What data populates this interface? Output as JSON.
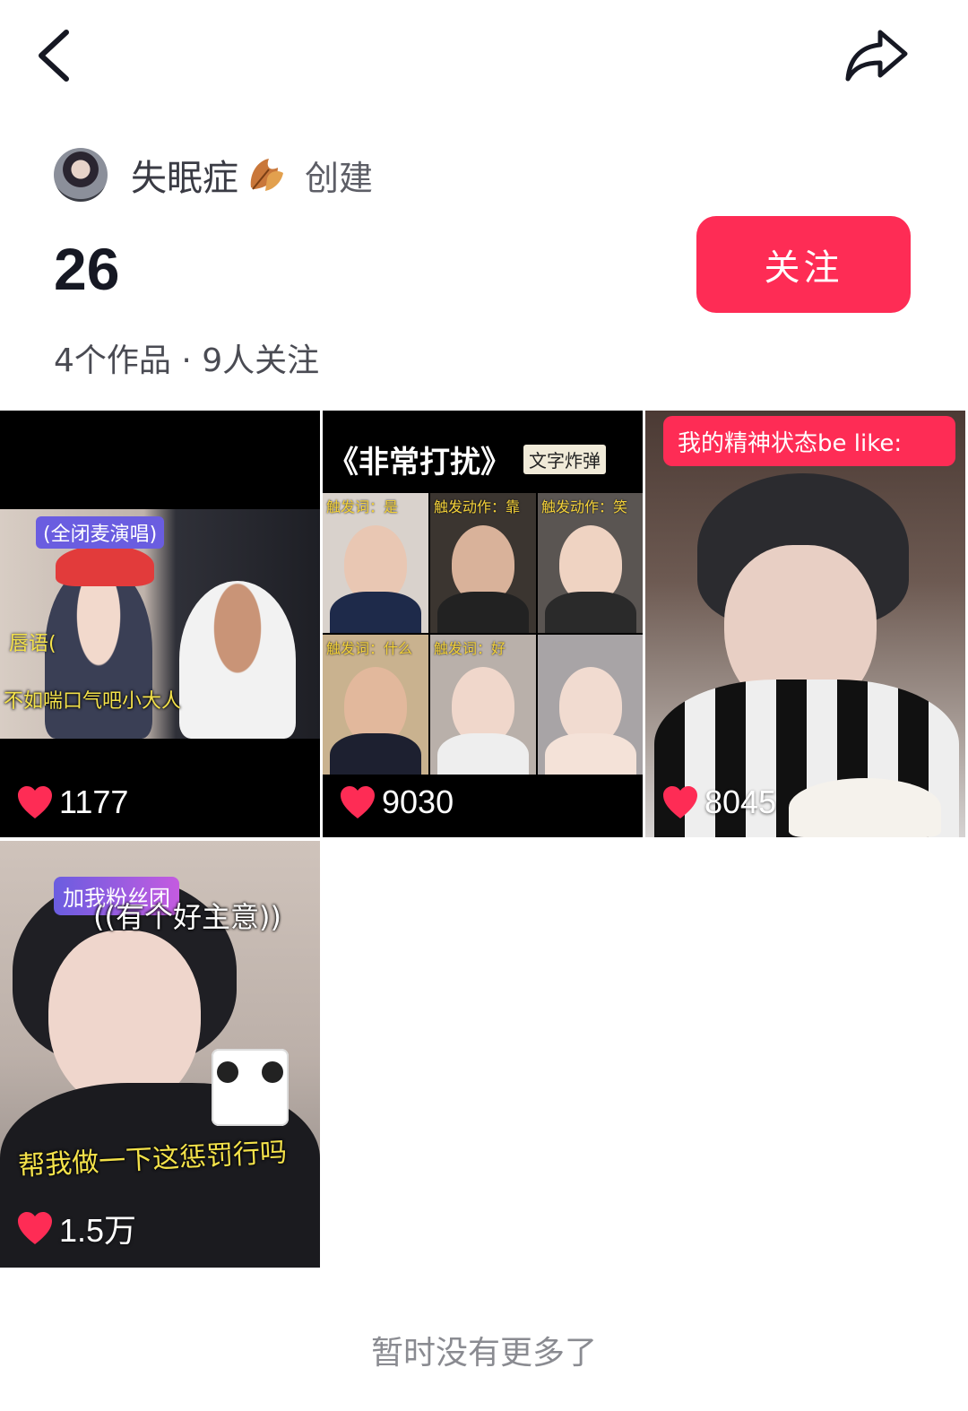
{
  "header": {
    "back_icon": "chevron-left-icon",
    "share_icon": "share-arrow-icon"
  },
  "creator": {
    "name": "失眠症",
    "name_emoji_icon": "maple-leaf-icon",
    "created_label": "创建"
  },
  "collection": {
    "count": "26",
    "stats": "4个作品 · 9人关注",
    "follow_label": "关注"
  },
  "colors": {
    "accent": "#fe2c55",
    "heart": "#fe2c55",
    "text_primary": "#161823",
    "text_secondary": "#8a8b91"
  },
  "videos": [
    {
      "likes": "1177",
      "captions": [
        "(全闭麦演唱)",
        "唇语(",
        "不如喘口气吧小大人"
      ]
    },
    {
      "likes": "9030",
      "title": "《非常打扰》",
      "tag": "文字炸弹",
      "cells": [
        "触发词：是",
        "触发动作：靠",
        "触发动作：笑",
        "触发词：什么",
        "触发词：好",
        ""
      ]
    },
    {
      "likes": "8045",
      "banner": "我的精神状态be like:"
    },
    {
      "likes": "1.5万",
      "badge": "加我粉丝团",
      "captions": [
        "((有个好主意))",
        "帮我做一下这惩罚行吗"
      ]
    }
  ],
  "footer": {
    "no_more": "暂时没有更多了"
  }
}
